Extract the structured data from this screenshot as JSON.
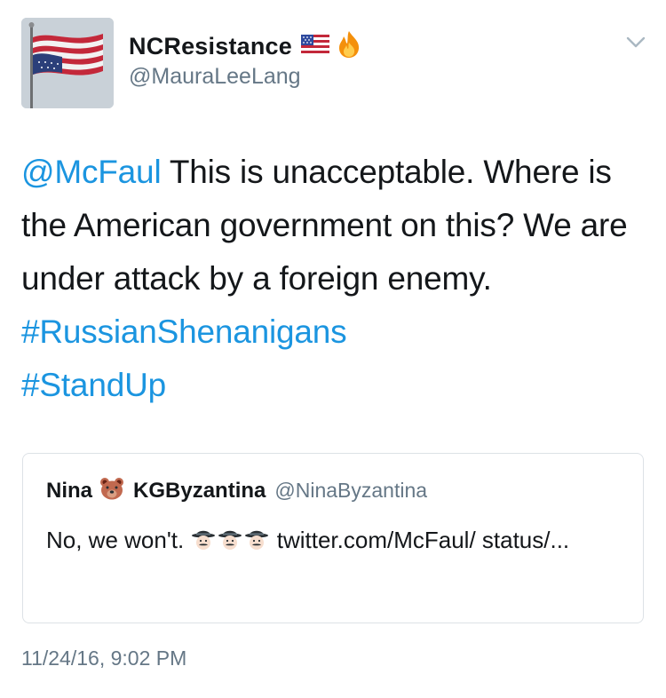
{
  "author": {
    "display_name": "NCResistance",
    "handle": "@MauraLeeLang",
    "name_emojis": [
      "us-flag-emoji",
      "fire-emoji"
    ]
  },
  "tweet": {
    "mention": "@McFaul",
    "text_part1": " This is unacceptable. Where is the American government on this? We are under attack by a foreign enemy. ",
    "hashtag1": "#RussianShenanigans",
    "hashtag2": "#StandUp",
    "timestamp": "11/24/16, 9:02 PM"
  },
  "quoted": {
    "name_part1": "Nina",
    "name_emoji": "bear-face-emoji",
    "name_part2": "KGByzantina",
    "handle": "@NinaByzantina",
    "text_start": "No, we won't.",
    "text_emojis": [
      "sleuth-emoji",
      "sleuth-emoji",
      "sleuth-emoji"
    ],
    "text_link": "twitter.com/McFaul/ status/..."
  },
  "colors": {
    "link": "#1b95e0",
    "text": "#14171a",
    "secondary": "#657786",
    "border": "#dde2e6"
  }
}
